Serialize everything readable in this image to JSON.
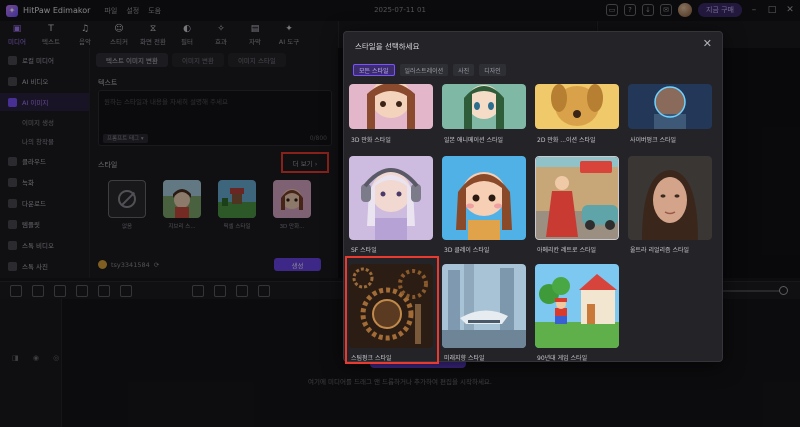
{
  "app": {
    "title": "HitPaw Edimakor",
    "menu": [
      "파일",
      "설정",
      "도움"
    ],
    "document_title": "2025-07-11 01",
    "upgrade_label": "지금 구매"
  },
  "toolbar": {
    "items": [
      {
        "label": "미디어",
        "icon": "folder-icon",
        "active": true
      },
      {
        "label": "텍스트",
        "icon": "text-icon",
        "active": false
      },
      {
        "label": "음악",
        "icon": "music-icon",
        "active": false
      },
      {
        "label": "스티커",
        "icon": "sticker-icon",
        "active": false
      },
      {
        "label": "화면 전환",
        "icon": "transition-icon",
        "active": false
      },
      {
        "label": "필터",
        "icon": "filter-icon",
        "active": false
      },
      {
        "label": "효과",
        "icon": "effect-icon",
        "active": false
      },
      {
        "label": "자막",
        "icon": "subtitle-icon",
        "active": false
      },
      {
        "label": "AI 도구",
        "icon": "ai-icon",
        "active": false
      }
    ]
  },
  "sidebar": {
    "items": [
      {
        "label": "로컬 미디어",
        "active": false
      },
      {
        "label": "AI 비디오",
        "active": false
      },
      {
        "label": "AI 이미지",
        "active": true
      }
    ],
    "subitems": [
      "이미지 생성",
      "나의 창작물"
    ],
    "items2": [
      "클라우드",
      "녹화",
      "다운로드",
      "템플릿",
      "스톡 비디오",
      "스톡 사진"
    ]
  },
  "panel": {
    "tabs": [
      "텍스트 이미지 변환",
      "이미지 변환",
      "이미지 스타일"
    ],
    "prompt_label": "텍스트",
    "prompt_placeholder": "원하는 스타일과 내용을 자세히 설명해 주세요",
    "tag_button": "프롬프트 태그 ▾",
    "counter": "0/800",
    "style_label": "스타일",
    "more_label": "더 보기 ›",
    "styles": [
      "없음",
      "지브리 스...",
      "픽셀 스타일",
      "3D 만화..."
    ],
    "credit": "tsy3341584",
    "generate_label": "생성"
  },
  "timeline": {
    "hint": "여기에 미디어를 드래그 앤 드롭하거나 추가하여 편집을 시작하세요."
  },
  "modal": {
    "title": "스타일을 선택하세요",
    "tabs": [
      {
        "label": "모든 스타일",
        "active": true
      },
      {
        "label": "일러스트레이션",
        "active": false
      },
      {
        "label": "사진",
        "active": false
      },
      {
        "label": "디자인",
        "active": false
      }
    ],
    "cards": [
      "3D 만화 스타일",
      "일본 애니메이션 스타일",
      "2D 만화 ...이션 스타일",
      "사이버펑크 스타일",
      "SF 스타일",
      "3D 클레이 스타일",
      "아메리칸 레트로 스타일",
      "울트라 리얼리즘 스타일",
      "스팀펑크 스타일",
      "미래지향 스타일",
      "90년대 게임 스타일"
    ],
    "selected": "스팀펑크 스타일"
  }
}
